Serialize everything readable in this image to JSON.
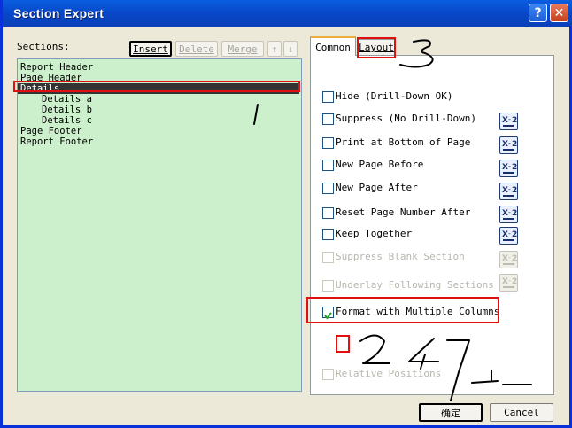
{
  "window": {
    "title": "Section Expert"
  },
  "sections_panel": {
    "label": "Sections:",
    "buttons": {
      "insert": "Insert",
      "delete": "Delete",
      "merge": "Merge"
    },
    "items": [
      "Report Header",
      "Page Header",
      "Details",
      "Details a",
      "Details b",
      "Details c",
      "Page Footer",
      "Report Footer"
    ],
    "selected_item": "Details"
  },
  "tabs": {
    "common": "Common",
    "layout": "Layout",
    "active": "Common"
  },
  "options": [
    {
      "label": "Hide (Drill-Down OK)",
      "checked": false,
      "enabled": true,
      "has_formula": false
    },
    {
      "label": "Suppress (No Drill-Down)",
      "checked": false,
      "enabled": true,
      "has_formula": true
    },
    {
      "label": "Print at Bottom of Page",
      "checked": false,
      "enabled": true,
      "has_formula": true
    },
    {
      "label": "New Page Before",
      "checked": false,
      "enabled": true,
      "has_formula": true
    },
    {
      "label": "New Page After",
      "checked": false,
      "enabled": true,
      "has_formula": true
    },
    {
      "label": "Reset Page Number After",
      "checked": false,
      "enabled": true,
      "has_formula": true
    },
    {
      "label": "Keep Together",
      "checked": false,
      "enabled": true,
      "has_formula": true
    },
    {
      "label": "Suppress Blank Section",
      "checked": false,
      "enabled": false,
      "has_formula": true
    },
    {
      "label": "Underlay Following Sections",
      "checked": false,
      "enabled": false,
      "has_formula": true
    },
    {
      "label": "Format with Multiple Columns",
      "checked": true,
      "enabled": true,
      "has_formula": false
    },
    {
      "label": "Relative Positions",
      "checked": false,
      "enabled": false,
      "has_formula": false
    }
  ],
  "footer": {
    "ok": "确定",
    "cancel": "Cancel"
  },
  "colors": {
    "title_bar": "#0A5FE0",
    "list_bg": "#CCF0CC",
    "highlight": "#E01010"
  }
}
